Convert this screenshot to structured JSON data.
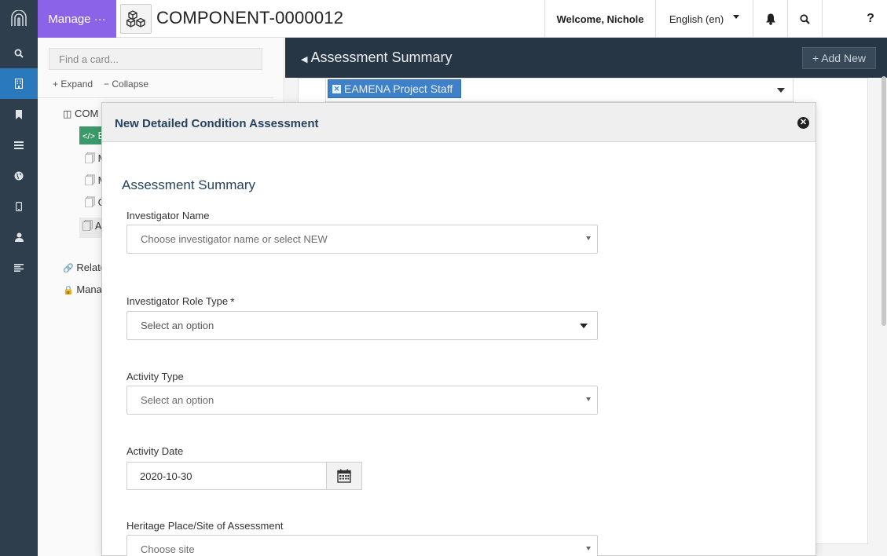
{
  "rail": {
    "items": [
      {
        "icon": "search-icon"
      },
      {
        "icon": "building-icon"
      },
      {
        "icon": "bookmark-icon"
      },
      {
        "icon": "list-icon"
      },
      {
        "icon": "globe-icon"
      },
      {
        "icon": "mobile-icon"
      },
      {
        "icon": "user-icon"
      },
      {
        "icon": "align-left-icon"
      }
    ]
  },
  "topbar": {
    "manage_label": "Manage ···",
    "resource_title": "COMPONENT-0000012",
    "welcome": "Welcome, Nichole",
    "language": "English (en)",
    "help": "?"
  },
  "tree": {
    "find_placeholder": "Find a card...",
    "expand": "+ Expand",
    "collapse": "− Collapse",
    "nodes": [
      "COM",
      "E",
      "M",
      "M",
      "G",
      "A",
      "Relate",
      "Manag"
    ]
  },
  "editor": {
    "header": "Assessment Summary",
    "add_new": "Add New",
    "chip": "EAMENA Project Staff"
  },
  "modal": {
    "title": "New Detailed Condition Assessment",
    "section": "Assessment Summary",
    "investigator_name_label": "Investigator Name",
    "investigator_name_placeholder": "Choose investigator name or select NEW",
    "role_type_label": "Investigator Role Type",
    "role_type_required": "*",
    "role_type_placeholder": "Select an option",
    "activity_type_label": "Activity Type",
    "activity_type_placeholder": "Select an option",
    "activity_date_label": "Activity Date",
    "activity_date_value": "2020-10-30",
    "site_label": "Heritage Place/Site of Assessment",
    "site_placeholder": "Choose site"
  },
  "colors": {
    "rail_bg": "#2f3e4d",
    "rail_active": "#2a79bd",
    "manage_bg": "#8a63e8",
    "editor_header_bg": "#263645",
    "chip_bg": "#3f81c8",
    "tree_selected": "#3c9a6a"
  }
}
